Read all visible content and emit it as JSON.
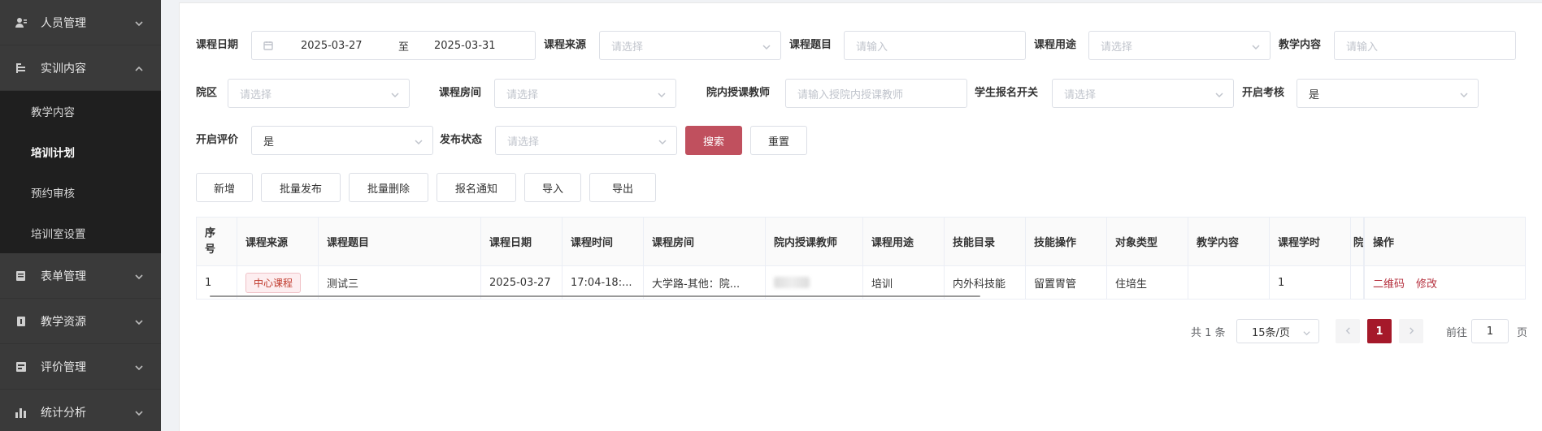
{
  "sidebar": {
    "items": [
      {
        "label": "人员管理",
        "icon": "user-icon",
        "expanded": false
      },
      {
        "label": "实训内容",
        "icon": "list-icon",
        "expanded": true
      },
      {
        "label": "表单管理",
        "icon": "form-icon",
        "expanded": false
      },
      {
        "label": "教学资源",
        "icon": "book-icon",
        "expanded": false
      },
      {
        "label": "评价管理",
        "icon": "rating-icon",
        "expanded": false
      },
      {
        "label": "统计分析",
        "icon": "bar-chart-icon",
        "expanded": false
      }
    ],
    "sub_items": [
      {
        "label": "教学内容",
        "active": false
      },
      {
        "label": "培训计划",
        "active": true
      },
      {
        "label": "预约审核",
        "active": false
      },
      {
        "label": "培训室设置",
        "active": false
      }
    ]
  },
  "filters": {
    "course_date": {
      "label": "课程日期",
      "start": "2025-03-27",
      "sep": "至",
      "end": "2025-03-31"
    },
    "course_source": {
      "label": "课程来源",
      "placeholder": "请选择"
    },
    "course_title": {
      "label": "课程题目",
      "placeholder": "请输入"
    },
    "course_usage": {
      "label": "课程用途",
      "placeholder": "请选择"
    },
    "teaching_content": {
      "label": "教学内容",
      "placeholder": "请输入"
    },
    "campus": {
      "label": "院区",
      "placeholder": "请选择"
    },
    "course_room": {
      "label": "课程房间",
      "placeholder": "请选择"
    },
    "teacher": {
      "label": "院内授课教师",
      "placeholder": "请输入授院内授课教师"
    },
    "enroll_switch": {
      "label": "学生报名开关",
      "placeholder": "请选择"
    },
    "exam_switch": {
      "label": "开启考核",
      "value": "是"
    },
    "eval_switch": {
      "label": "开启评价",
      "value": "是"
    },
    "publish_status": {
      "label": "发布状态",
      "placeholder": "请选择"
    },
    "search_label": "搜索",
    "reset_label": "重置"
  },
  "toolbar": {
    "add": "新增",
    "batch_publish": "批量发布",
    "batch_delete": "批量删除",
    "enroll_notice": "报名通知",
    "import": "导入",
    "export": "导出"
  },
  "table": {
    "headers": {
      "index_a": "序",
      "index_b": "号",
      "source": "课程来源",
      "title": "课程题目",
      "date": "课程日期",
      "time": "课程时间",
      "room": "课程房间",
      "teacher": "院内授课教师",
      "usage": "课程用途",
      "skill_dir": "技能目录",
      "skill_op": "技能操作",
      "target": "对象类型",
      "content": "教学内容",
      "hours": "课程学时",
      "extra": "院",
      "ops": "操作"
    },
    "rows": [
      {
        "index": "1",
        "source": "中心课程",
        "title": "测试三",
        "date": "2025-03-27",
        "time": "17:04-18:...",
        "room": "大学路-其他：院...",
        "usage": "培训",
        "skill_dir": "内外科技能",
        "skill_op": "留置胃管",
        "target": "住培生",
        "content": "",
        "hours": "1",
        "op_qr": "二维码",
        "op_edit": "修改"
      }
    ]
  },
  "pagination": {
    "total": "共 1 条",
    "page_size": "15条/页",
    "current": "1",
    "goto_prefix": "前往",
    "goto_value": "1",
    "goto_suffix": "页"
  },
  "colors": {
    "primary": "#c0505e",
    "active_page": "#a5192a",
    "sidebar_bg": "#3a3a3a",
    "submenu_bg": "#1f1f1f"
  }
}
